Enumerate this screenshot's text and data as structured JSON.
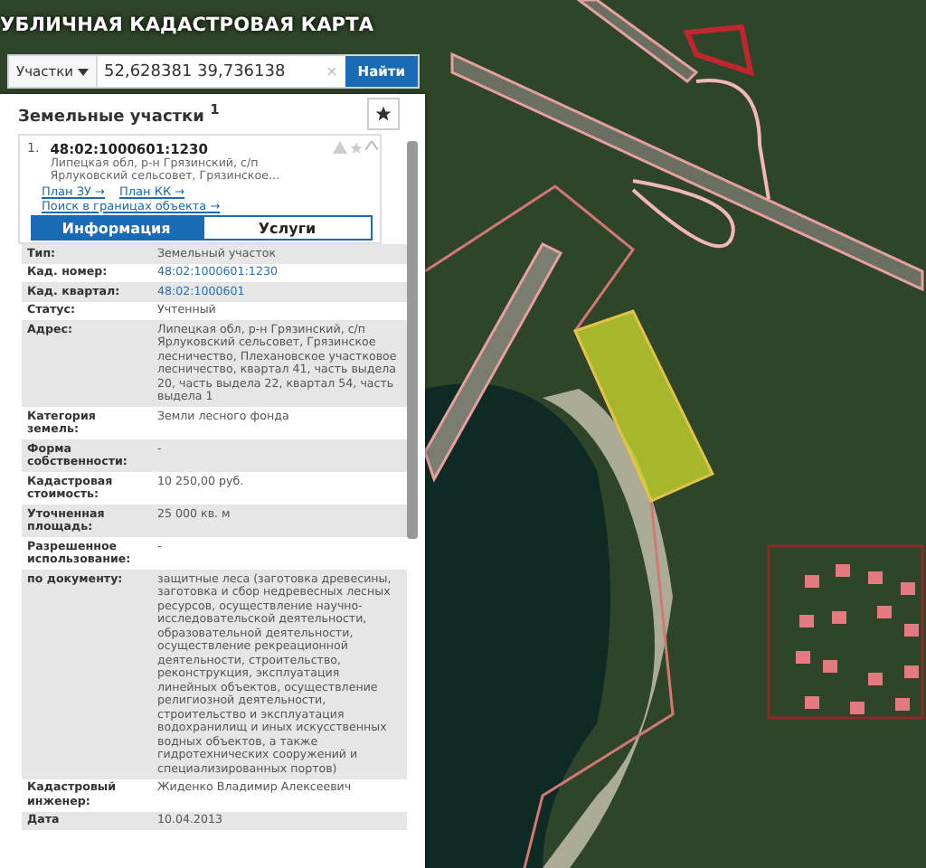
{
  "app_title": "УБЛИЧНАЯ КАДАСТРОВАЯ КАРТА",
  "search": {
    "type_selector": "Участки",
    "value": "52,628381 39,736138",
    "clear": "×",
    "button": "Найти"
  },
  "panel": {
    "title": "Земельные участки",
    "title_mark": "1",
    "result": {
      "index": "1.",
      "number": "48:02:1000601:1230",
      "address": "Липецкая обл, р-н Грязинский, с/п Ярлуковский сельсовет, Грязинское...",
      "links": [
        "План ЗУ →",
        "План КК →",
        "Поиск в границах объекта →"
      ]
    },
    "tabs": [
      {
        "label": "Информация",
        "selected": true
      },
      {
        "label": "Услуги",
        "selected": false
      }
    ],
    "rows": [
      {
        "label": "Тип:",
        "value": "Земельный участок",
        "kind": "text"
      },
      {
        "label": "Кад. номер:",
        "value": "48:02:1000601:1230",
        "kind": "link"
      },
      {
        "label": "Кад. квартал:",
        "value": "48:02:1000601",
        "kind": "link"
      },
      {
        "label": "Статус:",
        "value": "Учтенный",
        "kind": "text"
      },
      {
        "label": "Адрес:",
        "value": "Липецкая обл, р-н Грязинский, с/п Ярлуковский сельсовет, Грязинское лесничество, Плехановское участковое лесничество, квартал 41, часть выдела 20, часть выдела 22, квартал 54, часть выдела 1",
        "kind": "text"
      },
      {
        "label": "Категория земель:",
        "value": "Земли лесного фонда",
        "kind": "text"
      },
      {
        "label": "Форма собственности:",
        "value": "-",
        "kind": "text"
      },
      {
        "label": "Кадастровая стоимость:",
        "value": "10 250,00 руб.",
        "kind": "text"
      },
      {
        "label": "Уточненная площадь:",
        "value": "25 000 кв. м",
        "kind": "text"
      },
      {
        "label": "Разрешенное использование:",
        "value": "-",
        "kind": "text"
      },
      {
        "label": "по документу:",
        "value": "защитные леса (заготовка древесины, заготовка и сбор недревесных лесных ресурсов, осуществление научно-исследовательской деятельности, образовательной деятельности, осуществление рекреационной деятельности, строительство, реконструкция, эксплуатация линейных объектов, осуществление религиозной деятельности, строительство и эксплуатация водохранилищ и иных искусственных водных объектов, а также гидротехнических сооружений и специализированных портов)",
        "kind": "text"
      },
      {
        "label": "Кадастровый инженер:",
        "value": "Жиденко Владимир Алексеевич",
        "kind": "text"
      },
      {
        "label": "Дата",
        "value": "10.04.2013",
        "kind": "text"
      }
    ]
  }
}
